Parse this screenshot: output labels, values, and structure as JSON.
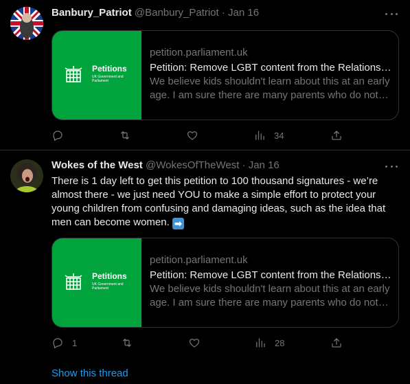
{
  "tweets": [
    {
      "display_name": "Banbury_Patriot",
      "handle": "@Banbury_Patriot",
      "separator": "·",
      "date": "Jan 16",
      "text": "",
      "card": {
        "thumb_title": "Petitions",
        "thumb_subtitle": "UK Government and Parliament",
        "domain": "petition.parliament.uk",
        "title": "Petition: Remove LGBT content from the Relationships and Sex Education curriculum",
        "description": "We believe kids shouldn't learn about this at an early age. I am sure there are many parents who do not want their children taught this."
      },
      "actions": {
        "replies": "",
        "retweets": "",
        "likes": "",
        "views": "34"
      }
    },
    {
      "display_name": "Wokes of the West",
      "handle": "@WokesOfTheWest",
      "separator": "·",
      "date": "Jan 16",
      "text": "There is 1 day left to get this petition to 100 thousand signatures - we’re almost there - we just need YOU to make a simple effort to protect your young children from confusing and damaging ideas, such as the idea that men can become women.",
      "emoji": "➡",
      "card": {
        "thumb_title": "Petitions",
        "thumb_subtitle": "UK Government and Parliament",
        "domain": "petition.parliament.uk",
        "title": "Petition: Remove LGBT content from the Relationships and Sex Education curriculum",
        "description": "We believe kids shouldn't learn about this at an early age. I am sure there are many parents who do not want their children taught this."
      },
      "actions": {
        "replies": "1",
        "retweets": "",
        "likes": "",
        "views": "28"
      }
    }
  ],
  "show_thread": "Show this thread",
  "icons": [
    "more-icon",
    "reply-icon",
    "retweet-icon",
    "like-icon",
    "views-icon",
    "share-icon",
    "portcullis-icon"
  ],
  "colors": {
    "background": "#000000",
    "text": "#e7e9ea",
    "muted": "#71767b",
    "link": "#1d9bf0",
    "petitions_green": "#00a33c",
    "border": "#2f3336"
  }
}
